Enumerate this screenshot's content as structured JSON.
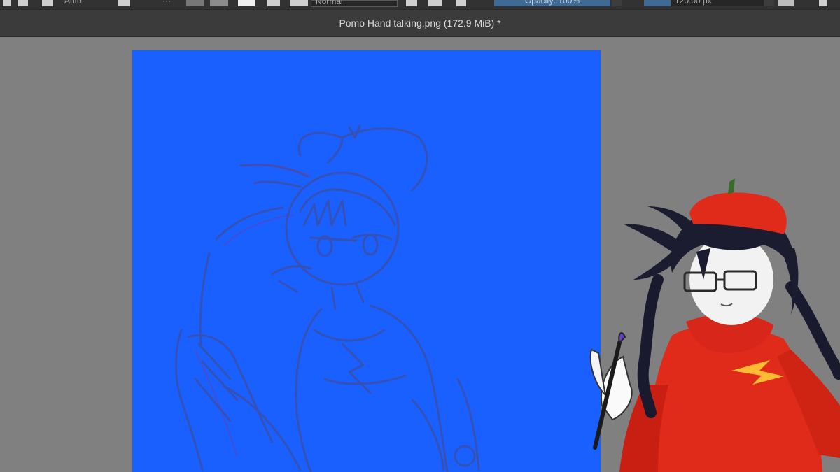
{
  "toolbar": {
    "size_label": "Auto",
    "blend_mode": "Normal",
    "opacity": "Opacity: 100%",
    "brush_size": "120.00 px",
    "icons": [
      "transform-icon",
      "mirror-icon",
      "swatch-icon",
      "layers-icon",
      "undo-icon",
      "redo-icon",
      "play-icon"
    ]
  },
  "document": {
    "title": "Pomo Hand talking.png (172.9 MiB) *"
  },
  "canvas": {
    "background_color": "#1a5fff",
    "content": "sketch"
  },
  "colors": {
    "app_background": "#808080",
    "toolbar": "#323232",
    "tabbar": "#3b3b3b",
    "accent": "#3f6a93",
    "sketch_line": "#3a4fa8",
    "mascot_red": "#e82c1c"
  }
}
